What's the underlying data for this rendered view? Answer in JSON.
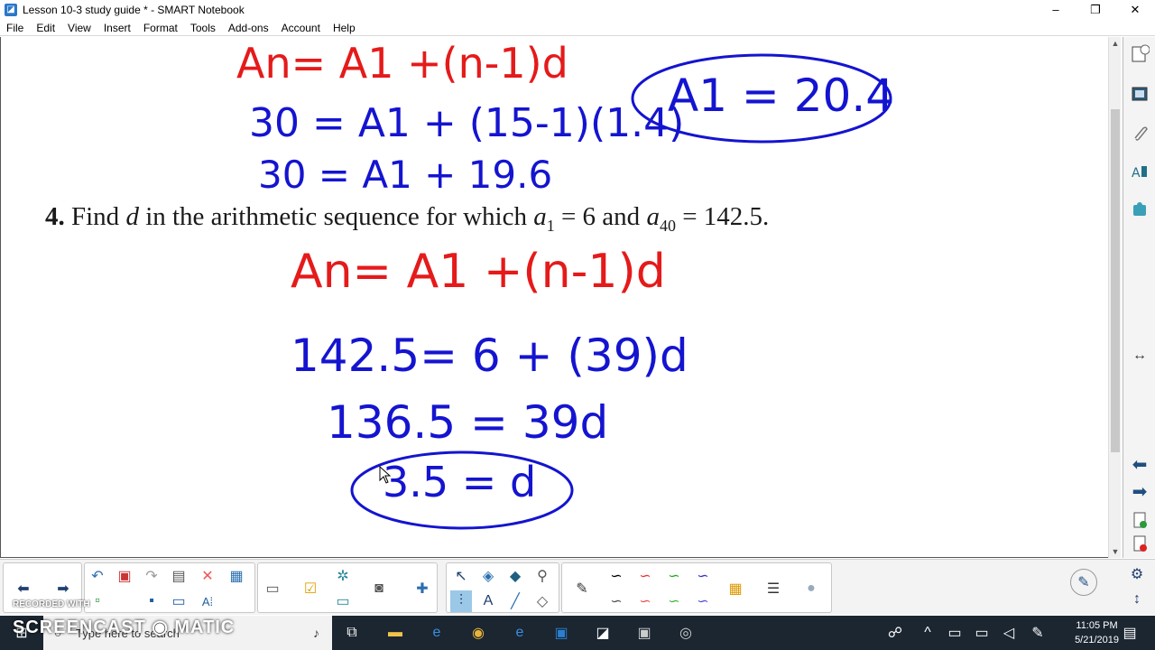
{
  "window": {
    "title": "Lesson 10-3 study guide * - SMART Notebook",
    "minimize": "–",
    "maximize": "❐",
    "close": "✕"
  },
  "menu": [
    "File",
    "Edit",
    "View",
    "Insert",
    "Format",
    "Tools",
    "Add-ons",
    "Account",
    "Help"
  ],
  "canvas": {
    "top_work": {
      "formula": "An= A1 +(n-1)d",
      "line1": "30 = A1 + (15-1)(1.4)",
      "line2": "30 = A1 + 19.6",
      "answer": "A1 = 20.4"
    },
    "question": {
      "number": "4.",
      "pre": "Find",
      "var": "d",
      "mid": "in the arithmetic sequence for which",
      "a1": "a",
      "a1_sub": "1",
      "eq1": "= 6 and",
      "a40": "a",
      "a40_sub": "40",
      "eq2": "= 142.5."
    },
    "work": {
      "formula": "An= A1 +(n-1)d",
      "line1": "142.5= 6 + (39)d",
      "line2": "136.5 = 39d",
      "answer": "3.5 = d"
    }
  },
  "taskbar": {
    "search_placeholder": "Type here to search",
    "time": "11:05 PM",
    "date": "5/21/2019"
  },
  "watermark": {
    "line1": "RECORDED WITH",
    "line2": "SCREENCAST ◉ MATIC"
  },
  "colors": {
    "ink_red": "#e51a1a",
    "ink_blue": "#1414d0",
    "taskbar": "#1b2631"
  }
}
